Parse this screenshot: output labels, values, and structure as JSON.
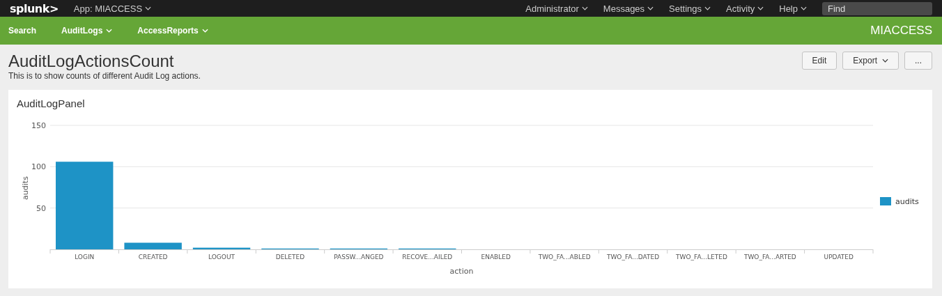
{
  "topbar": {
    "logo": "splunk>",
    "app_menu": "App: MIACCESS",
    "menus": [
      "Administrator",
      "Messages",
      "Settings",
      "Activity",
      "Help"
    ],
    "search": {
      "placeholder": "Find"
    }
  },
  "appbar": {
    "items": [
      {
        "label": "Search",
        "dropdown": false
      },
      {
        "label": "AuditLogs",
        "dropdown": true
      },
      {
        "label": "AccessReports",
        "dropdown": true
      }
    ],
    "app_name": "MIACCESS"
  },
  "dashboard": {
    "title": "AuditLogActionsCount",
    "description": "This is to show counts of different Audit Log actions.",
    "buttons": [
      {
        "label": "Edit",
        "dropdown": false
      },
      {
        "label": "Export",
        "dropdown": true
      },
      {
        "label": "...",
        "dropdown": false
      }
    ]
  },
  "panel": {
    "title": "AuditLogPanel",
    "chart_data": {
      "type": "bar",
      "xlabel": "action",
      "ylabel": "audits",
      "categories": [
        "LOGIN",
        "CREATED",
        "LOGOUT",
        "DELETED",
        "PASSW...ANGED",
        "RECOVE...AILED",
        "ENABLED",
        "TWO_FA...ABLED",
        "TWO_FA...DATED",
        "TWO_FA...LETED",
        "TWO_FA...ARTED",
        "UPDATED"
      ],
      "ylim": [
        0,
        150
      ],
      "yticks": [
        50,
        100,
        150
      ],
      "series": [
        {
          "name": "audits",
          "color": "#1e93c6",
          "values": [
            106,
            8,
            2,
            1,
            1,
            1,
            0,
            0,
            0,
            0,
            0,
            0
          ]
        }
      ]
    }
  }
}
